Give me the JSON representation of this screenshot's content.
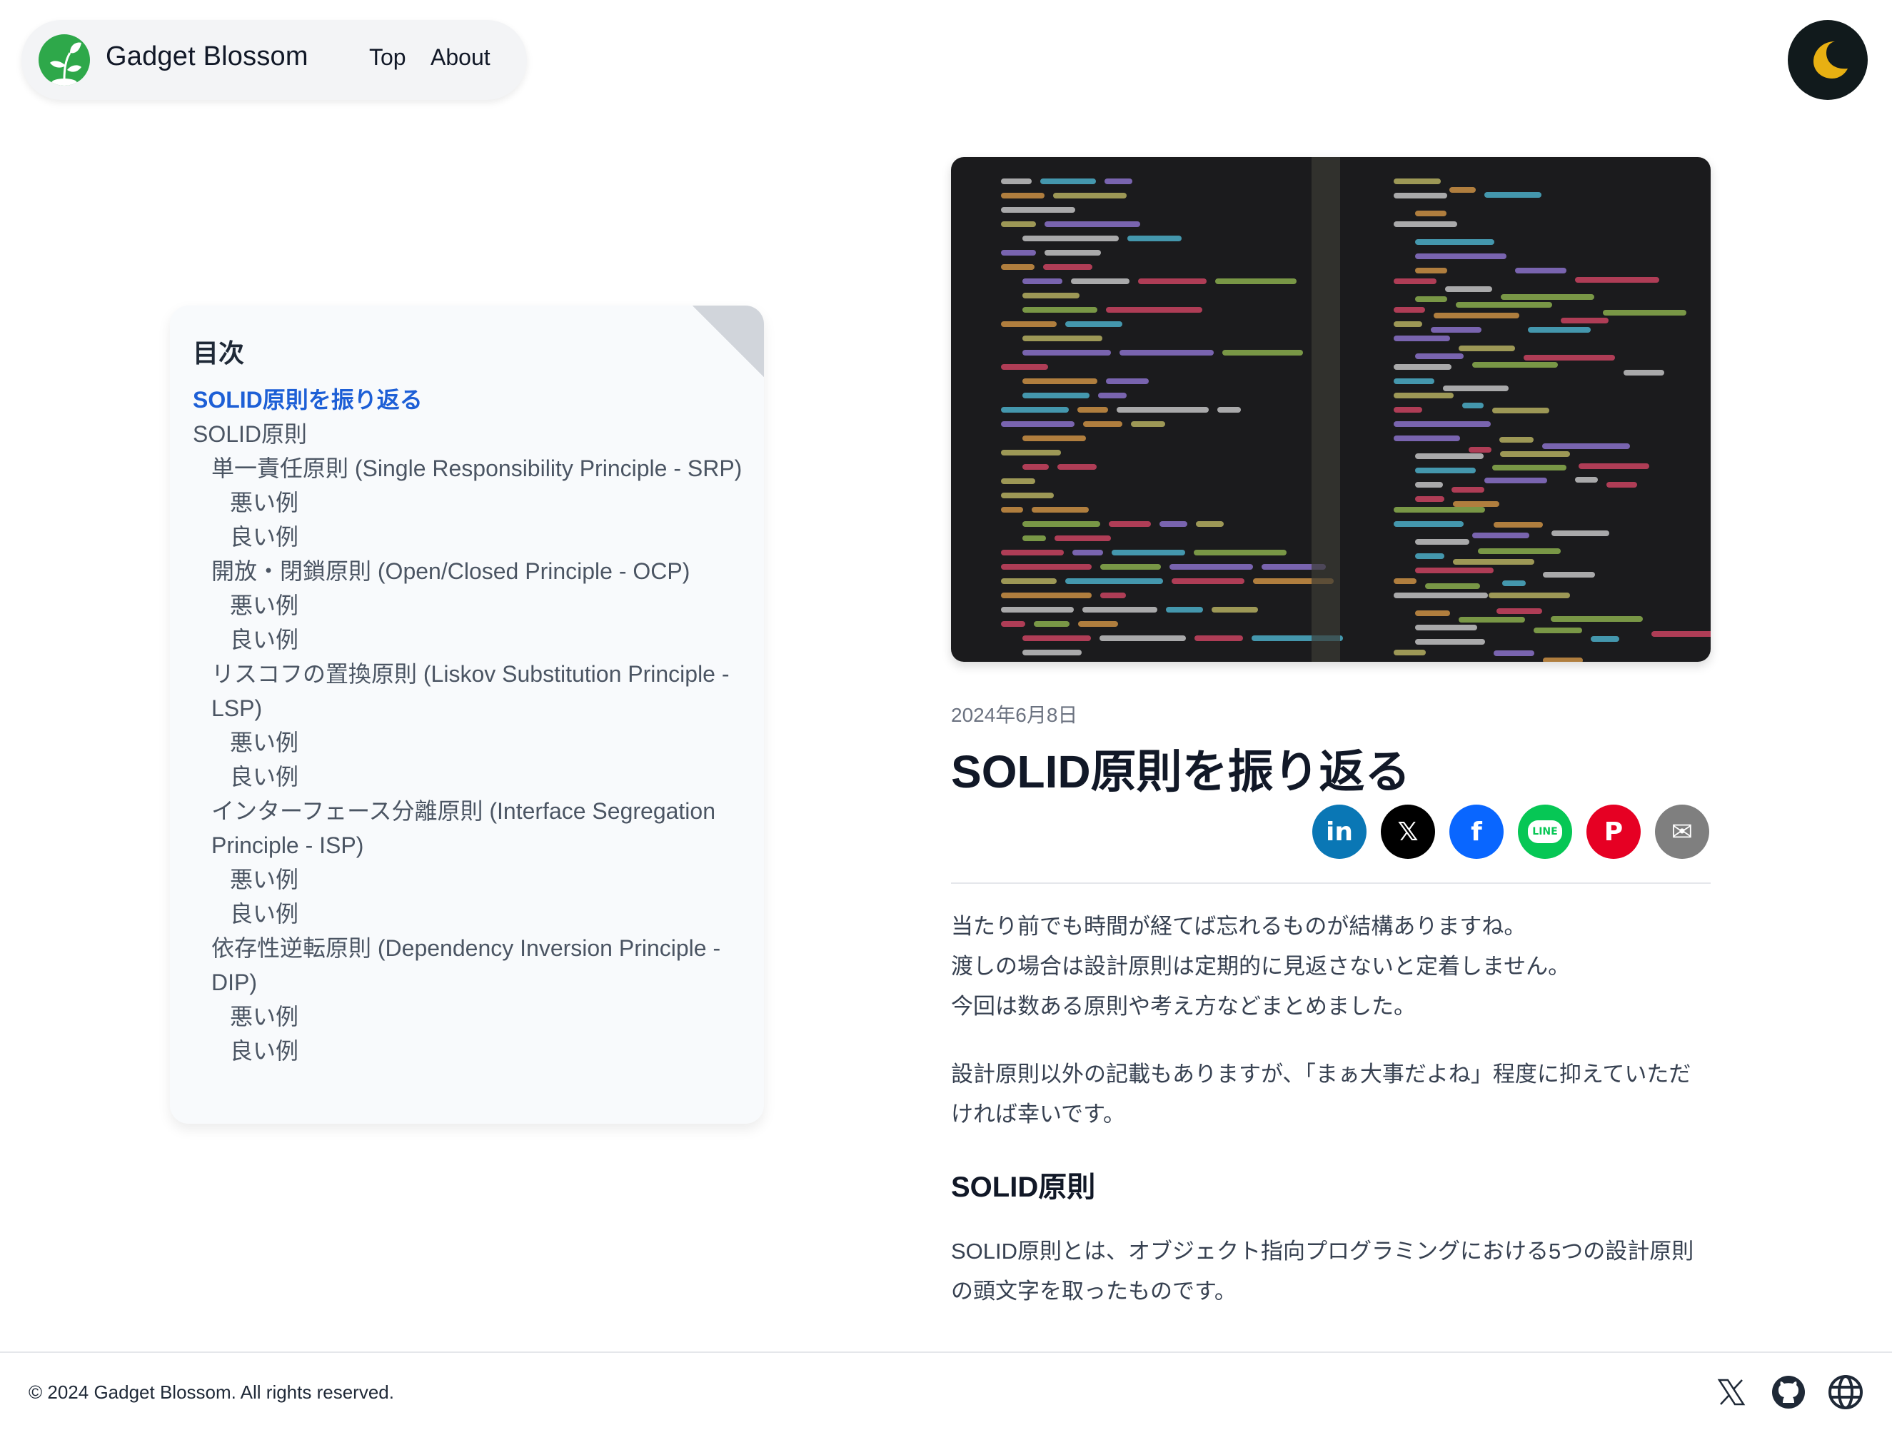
{
  "header": {
    "brand": "Gadget Blossom",
    "nav": [
      {
        "label": "Top"
      },
      {
        "label": "About"
      }
    ],
    "logo_icon": "sprout-logo",
    "theme_toggle_icon": "moon-icon"
  },
  "toc": {
    "title": "目次",
    "items": [
      {
        "label": "SOLID原則を振り返る",
        "level": 0,
        "active": true
      },
      {
        "label": "SOLID原則",
        "level": 1
      },
      {
        "label": "単一責任原則 (Single Responsibility Principle - SRP)",
        "level": 2
      },
      {
        "label": "悪い例",
        "level": 3
      },
      {
        "label": "良い例",
        "level": 3
      },
      {
        "label": "開放・閉鎖原則 (Open/Closed Principle - OCP)",
        "level": 2
      },
      {
        "label": "悪い例",
        "level": 3
      },
      {
        "label": "良い例",
        "level": 3
      },
      {
        "label": "リスコフの置換原則 (Liskov Substitution Principle - LSP)",
        "level": 2
      },
      {
        "label": "悪い例",
        "level": 3
      },
      {
        "label": "良い例",
        "level": 3
      },
      {
        "label": "インターフェース分離原則 (Interface Segregation Principle - ISP)",
        "level": 2
      },
      {
        "label": "悪い例",
        "level": 3
      },
      {
        "label": "良い例",
        "level": 3
      },
      {
        "label": "依存性逆転原則 (Dependency Inversion Principle - DIP)",
        "level": 2
      },
      {
        "label": "悪い例",
        "level": 3
      },
      {
        "label": "良い例",
        "level": 3
      }
    ]
  },
  "article": {
    "hero_alt": "code editor screenshot",
    "date": "2024年6月8日",
    "title": "SOLID原則を振り返る",
    "share": [
      {
        "name": "linkedin",
        "label": "in",
        "color": "#0a77b5"
      },
      {
        "name": "x",
        "label": "𝕏",
        "color": "#000000"
      },
      {
        "name": "facebook",
        "label": "f",
        "color": "#0966ff"
      },
      {
        "name": "line",
        "label": "LINE",
        "color": "#06c755"
      },
      {
        "name": "pinterest",
        "label": "P",
        "color": "#e60023"
      },
      {
        "name": "email",
        "label": "✉",
        "color": "#7f7f7f"
      }
    ],
    "intro_lines": [
      "当たり前でも時間が経てば忘れるものが結構ありますね。",
      "渡しの場合は設計原則は定期的に見返さないと定着しません。",
      "今回は数ある原則や考え方などまとめました。"
    ],
    "para2": "設計原則以外の記載もありますが、「まぁ大事だよね」程度に抑えていただければ幸いです。",
    "h2": "SOLID原則",
    "para3": "SOLID原則とは、オブジェクト指向プログラミングにおける5つの設計原則の頭文字を取ったものです。"
  },
  "footer": {
    "copyright": "© 2024 Gadget Blossom. All rights reserved.",
    "icons": [
      "x-icon",
      "github-icon",
      "globe-icon"
    ]
  },
  "colors": {
    "accent_link": "#1d5fd6",
    "logo_green": "#2ea84a",
    "moon_yellow": "#e8b012"
  }
}
